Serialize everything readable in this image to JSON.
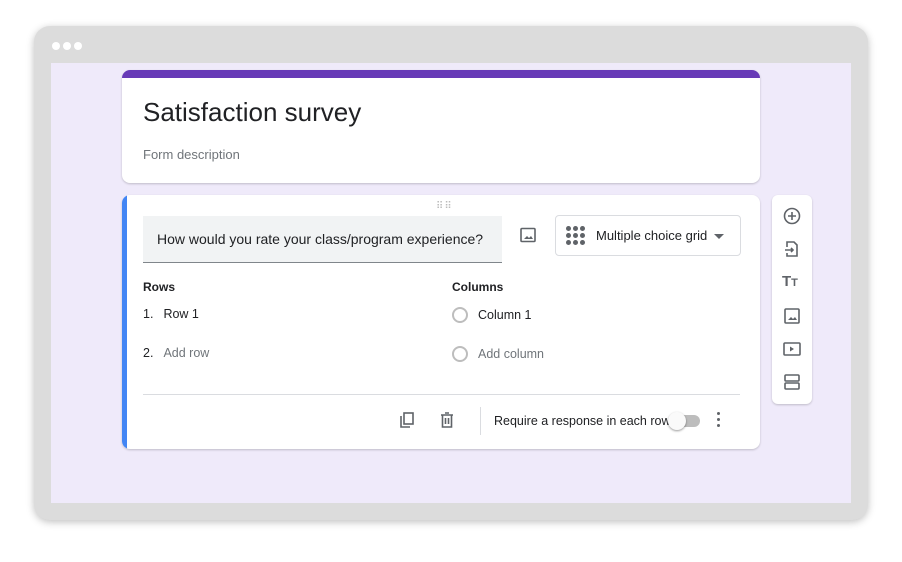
{
  "form": {
    "title": "Satisfaction survey",
    "description": "Form description"
  },
  "question": {
    "text": "How would you rate your class/program experience?",
    "type": "Multiple choice grid",
    "rows_label": "Rows",
    "columns_label": "Columns",
    "rows": [
      {
        "num": "1.",
        "label": "Row 1"
      },
      {
        "num": "2.",
        "label": "Add row"
      }
    ],
    "columns": [
      {
        "label": "Column 1"
      },
      {
        "label": "Add column"
      }
    ],
    "require_label": "Require a response in each row",
    "require_on": false
  },
  "colors": {
    "header": "#673ab7",
    "active": "#4285f4"
  }
}
